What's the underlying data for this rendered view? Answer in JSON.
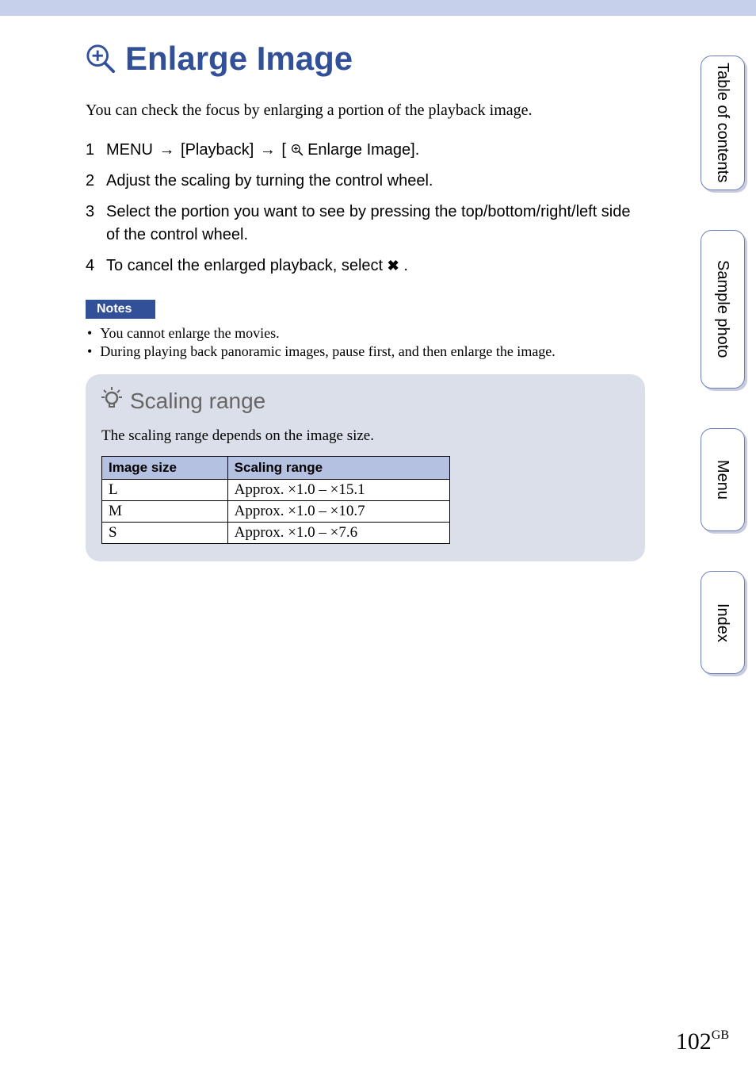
{
  "title": "Enlarge Image",
  "intro": "You can check the focus by enlarging a portion of the playback image.",
  "steps": {
    "s1_pre": "MENU ",
    "s1_mid1": " [Playback] ",
    "s1_mid2": " [",
    "s1_post": " Enlarge Image].",
    "s2": "Adjust the scaling by turning the control wheel.",
    "s3": "Select the portion you want to see by pressing the top/bottom/right/left side of the control wheel.",
    "s4_pre": "To cancel the enlarged playback, select ",
    "s4_post": " ."
  },
  "notes": {
    "heading": "Notes",
    "items": [
      "You cannot enlarge the movies.",
      "During playing back panoramic images, pause first, and then enlarge the image."
    ]
  },
  "tip": {
    "title": "Scaling range",
    "desc": "The scaling range depends on the image size.",
    "table": {
      "headers": [
        "Image size",
        "Scaling range"
      ],
      "rows": [
        [
          "L",
          "Approx. ×1.0 – ×15.1"
        ],
        [
          "M",
          "Approx. ×1.0 – ×10.7"
        ],
        [
          "S",
          "Approx. ×1.0 – ×7.6"
        ]
      ]
    }
  },
  "side_tabs": [
    "Table of contents",
    "Sample photo",
    "Menu",
    "Index"
  ],
  "page_number": "102",
  "page_suffix": "GB",
  "icons": {
    "arrow": "→"
  }
}
